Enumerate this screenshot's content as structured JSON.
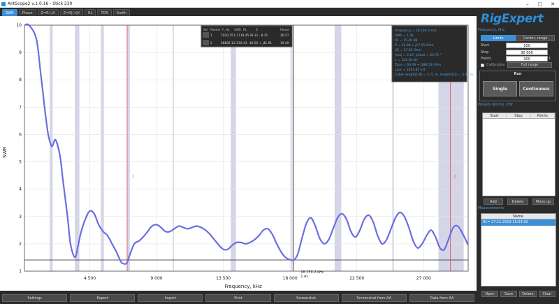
{
  "window": {
    "title": "AntScope2 v.1.0.16 - Stick 230"
  },
  "tabs": [
    "SWR",
    "Phase",
    "Z=R+jX",
    "Z=R||+jX",
    "RL",
    "TDR",
    "Smith"
  ],
  "active_tab": "SWR",
  "logo_text": "RigExpert",
  "frequency": {
    "section_label": "Frequency, kHz",
    "limits_label": "Limits",
    "center_range_label": "Center, range",
    "start_label": "Start",
    "start_value": "100",
    "stop_label": "Stop",
    "stop_value": "30 000",
    "points_label": "Points",
    "points_value": "300",
    "calibration_label": "Calibration",
    "full_range_label": "Full range"
  },
  "run": {
    "title": "Run",
    "single_label": "Single",
    "continuous_label": "Continuous"
  },
  "presets": {
    "section_label": "Presets (limits), kHz",
    "columns": [
      "Start",
      "Stop",
      "Points"
    ],
    "add_label": "Add",
    "delete_label": "Delete",
    "moveup_label": "Move up"
  },
  "measurements": {
    "section_label": "Measurements",
    "column": "Name",
    "row": "01= 27.11.2019 15:53:02",
    "open_label": "Open",
    "save_label": "Save",
    "delete_label": "Delete",
    "clear_label": "Clear"
  },
  "bottom_buttons": [
    "Settings",
    "Export",
    "Import",
    "Print",
    "Screenshot",
    "Screenshot from AA",
    "Data from AA"
  ],
  "markers_table": {
    "headers": [
      "Sel",
      "Marker",
      "F, Hz",
      "SWR",
      "RL",
      "Z",
      "",
      "Phase"
    ],
    "rows": [
      [
        "1",
        "7020.35",
        "1.27",
        "18.45",
        "39.31 - 8.35",
        "",
        "26.57"
      ],
      [
        "2",
        "28802.1",
        "2.21",
        "8.43",
        "40.02 + j41.91",
        "",
        "19.49"
      ]
    ]
  },
  "info_box": [
    "Frequency = 18 239.2 kHz",
    "SWR = 1.41",
    "RL = 15.40 dB",
    "Z = 54.88 + j17.55 Ohm",
    "|Z| = 57.62 Ohm",
    "|rho| = 0.17, phase = 63.79 °",
    "L = 153.10 nH",
    "Zpar = 60.49 + j189.52 Ohm",
    "Lpar = 1653.85 nH",
    "Cable length(1/4) = 2.71 m, length(1/2) = 5.42 m"
  ],
  "cursor_label": [
    "18 239.2 kHz",
    "1.41"
  ],
  "marker_labels": [
    "1",
    "2"
  ],
  "chart_data": {
    "type": "line",
    "xlabel": "Frequency, kHz",
    "ylabel": "SWR",
    "xlim": [
      100,
      30000
    ],
    "ylim": [
      1,
      10
    ],
    "x_ticks": [
      4500,
      9000,
      13500,
      18000,
      22500,
      27000
    ],
    "x_tick_labels": [
      "4 500",
      "9 000",
      "13 500",
      "18 000",
      "22 500",
      "27 000"
    ],
    "y_ticks": [
      1,
      2,
      3,
      4,
      5,
      6,
      7,
      8,
      9,
      10
    ],
    "grid": true,
    "bands_khz": [
      [
        1800,
        2000
      ],
      [
        3500,
        3800
      ],
      [
        5250,
        5450
      ],
      [
        7000,
        7200
      ],
      [
        10100,
        10150
      ],
      [
        14000,
        14350
      ],
      [
        18068,
        18168
      ],
      [
        21000,
        21450
      ],
      [
        24890,
        24990
      ],
      [
        28000,
        29700
      ]
    ],
    "markers_khz": [
      7020,
      28802
    ],
    "cursor_khz": 18239,
    "reference_swr": 1.41,
    "colors": {
      "line": "#6a6ee0",
      "band": "#c7c7e0",
      "marker": "#e05050",
      "band_marker": "#c090c0"
    },
    "series": [
      {
        "x": [
          100,
          400,
          900,
          1200,
          1500,
          1700,
          1900,
          2000,
          2200,
          2500,
          2700,
          3000,
          3200,
          3500,
          3700,
          3900,
          4200,
          4500,
          4800,
          5100,
          5400,
          5700,
          6000,
          6300,
          6600,
          6800,
          7000,
          7200,
          7500,
          7800,
          8100,
          8400,
          8700,
          9000,
          9300,
          9600,
          9900,
          10200,
          10500,
          10800,
          11100,
          11400,
          11700,
          12000,
          12300,
          12600,
          12900,
          13200,
          13500,
          13800,
          14100,
          14400,
          14700,
          15000,
          15300,
          15600,
          15900,
          16200,
          16500,
          16800,
          17100,
          17400,
          17700,
          18000,
          18239,
          18500,
          18800,
          19100,
          19400,
          19700,
          20000,
          20300,
          20600,
          20900,
          21200,
          21500,
          21800,
          22100,
          22400,
          22700,
          23000,
          23300,
          23600,
          23900,
          24200,
          24500,
          24800,
          25100,
          25400,
          25700,
          26000,
          26300,
          26600,
          26900,
          27200,
          27500,
          27800,
          28100,
          28400,
          28700,
          29000,
          29300,
          29600,
          30000
        ],
        "y": [
          10,
          10,
          9.5,
          8.2,
          6.8,
          6.0,
          5.6,
          5.6,
          5.8,
          5.2,
          4.3,
          3.0,
          2.0,
          1.5,
          1.9,
          2.4,
          2.9,
          3.2,
          3.1,
          2.7,
          2.45,
          2.3,
          2.0,
          1.7,
          1.35,
          1.27,
          1.3,
          1.6,
          2.0,
          2.1,
          2.25,
          2.45,
          2.65,
          2.7,
          2.6,
          2.45,
          2.45,
          2.55,
          2.65,
          2.6,
          2.55,
          2.6,
          2.65,
          2.6,
          2.5,
          2.35,
          2.15,
          1.95,
          1.8,
          1.8,
          1.95,
          2.05,
          2.05,
          2.0,
          2.05,
          2.15,
          2.3,
          2.5,
          2.55,
          2.35,
          2.0,
          1.7,
          1.5,
          1.42,
          1.41,
          1.6,
          2.2,
          2.75,
          2.95,
          2.65,
          2.2,
          2.0,
          2.15,
          2.55,
          2.95,
          3.1,
          2.9,
          2.45,
          2.25,
          2.5,
          2.9,
          3.05,
          2.8,
          2.3,
          2.0,
          2.15,
          2.55,
          2.95,
          3.15,
          3.0,
          2.6,
          2.1,
          1.85,
          2.0,
          2.3,
          2.5,
          2.25,
          1.85,
          1.8,
          2.2,
          2.6,
          2.65,
          2.4,
          1.95
        ]
      }
    ]
  }
}
